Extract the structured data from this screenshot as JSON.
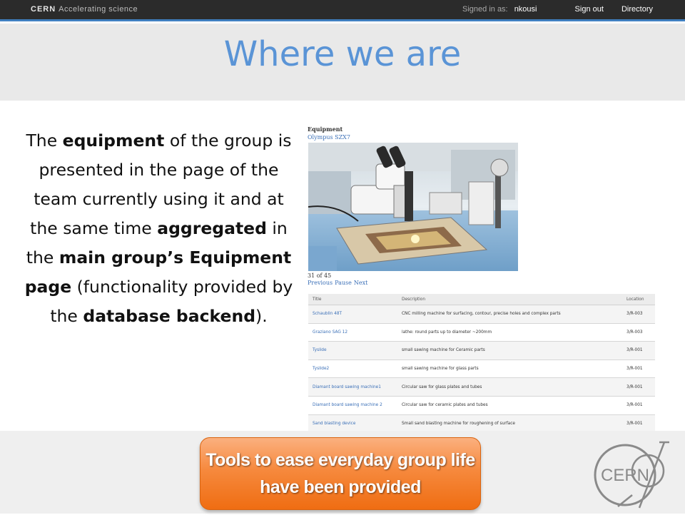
{
  "topbar": {
    "brand": "CERN",
    "tagline": "Accelerating science",
    "signed_in_label": "Signed in as:",
    "username": "nkousi",
    "sign_out": "Sign out",
    "directory": "Directory"
  },
  "slide": {
    "title": "Where we are",
    "body": [
      {
        "text": "The ",
        "bold": false
      },
      {
        "text": "equipment",
        "bold": true
      },
      {
        "text": " of the group is presented in the page of the team currently using it and at the same time ",
        "bold": false
      },
      {
        "text": "aggregated",
        "bold": true
      },
      {
        "text": " in the ",
        "bold": false
      },
      {
        "text": "main group’s Equipment page",
        "bold": true
      },
      {
        "text": " (functionality provided by the ",
        "bold": false
      },
      {
        "text": "database backend",
        "bold": true
      },
      {
        "text": ").",
        "bold": false
      }
    ],
    "callout": "Tools to ease everyday group life have been provided",
    "logo_text": "CERN"
  },
  "equipment": {
    "heading": "Equipment",
    "item_name": "Olympus SZX7",
    "counter": "31 of 45",
    "nav": [
      "Previous",
      "Pause",
      "Next"
    ],
    "columns": [
      "Title",
      "Description",
      "Location"
    ],
    "rows": [
      [
        "Schaublin 48T",
        "CNC milling machine for surfacing, contour, precise holes and complex parts",
        "3/R-003"
      ],
      [
        "Graziano SAG 12",
        "lathe: round parts up to diameter ~200mm",
        "3/R-003"
      ],
      [
        "Tyslide",
        "small sawing machine for Ceramic parts",
        "3/R-001"
      ],
      [
        "Tyslide2",
        "small sawing machine for glass parts",
        "3/R-001"
      ],
      [
        "Diamant board sawing machine1",
        "Circular saw for glass plates and tubes",
        "3/R-001"
      ],
      [
        "Diamant board sawing machine 2",
        "Circular saw for ceramic plates and tubes",
        "3/R-001"
      ],
      [
        "Sand blasting device",
        "Small sand blasting machine for roughening of surface",
        "3/R-001"
      ]
    ]
  },
  "colors": {
    "title_blue": "#5a94d6",
    "topbar_bg": "#2b2b2b",
    "topbar_accent": "#3f7fbf",
    "callout_orange": "#f6893d",
    "link_blue": "#3a6fb7"
  }
}
